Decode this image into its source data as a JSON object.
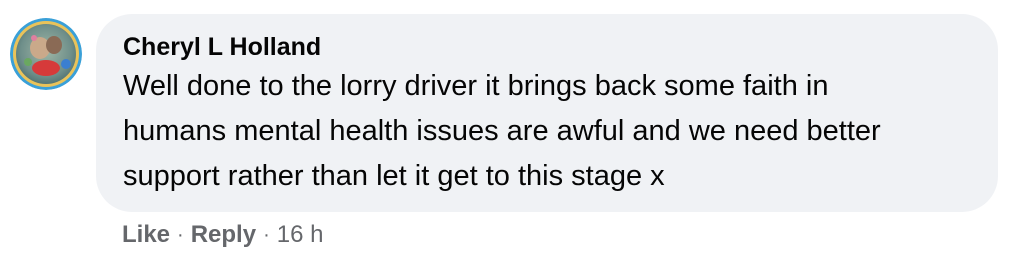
{
  "comment": {
    "author": "Cheryl L Holland",
    "text": "Well done to the lorry driver it brings back some faith in\nhumans mental health issues are awful and we need better\nsupport rather than let it get to this stage x",
    "actions": {
      "like_label": "Like",
      "separator": "·",
      "reply_label": "Reply",
      "timestamp": "16 h"
    },
    "avatar_icon": "profile-photo-avatar",
    "colors": {
      "bubble": "#f0f2f5",
      "text": "#050505",
      "meta": "#65676b"
    }
  }
}
